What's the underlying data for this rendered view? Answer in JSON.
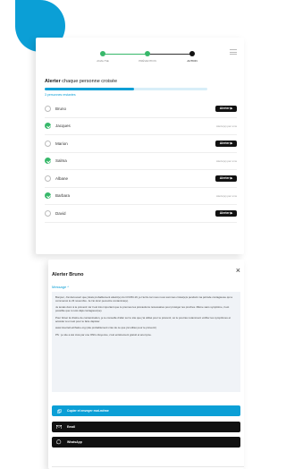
{
  "colors": {
    "accent": "#0b9fd6",
    "success": "#37b86a",
    "dark": "#111111"
  },
  "stepper": {
    "steps": [
      {
        "label": "Analyse",
        "state": "done"
      },
      {
        "label": "Prévention",
        "state": "done"
      },
      {
        "label": "Action",
        "state": "current"
      }
    ]
  },
  "alert_panel": {
    "title_bold": "Alerter",
    "title_rest": " chaque personne croisée",
    "progress_fraction": 0.55,
    "done_text": "3 personnes restantes",
    "alert_label": "Alerter ▶",
    "alerted_label": "Alerté(e) par sms",
    "people": [
      {
        "name": "Bruno",
        "checked": false
      },
      {
        "name": "Jacques",
        "checked": true
      },
      {
        "name": "Marion",
        "checked": false
      },
      {
        "name": "Salma",
        "checked": true
      },
      {
        "name": "Albane",
        "checked": false
      },
      {
        "name": "Barbara",
        "checked": true
      },
      {
        "name": "David",
        "checked": false
      }
    ]
  },
  "modal": {
    "title": "Alerter Bruno",
    "close": "×",
    "message_toggle": "Message ^",
    "paragraphs": [
      "Bonjour, J'ai découvert que j'étais probablement atteint(e) du COVID-19, je t'écris car nous nous sommes croisé(e)s pendant ma période contagieuse qui a commencé le 23 novembre. Je t'ai donc peut-être contaminé(e).",
      "Je tenais donc à te prévenir car il est très important que tu prennes les précautions nécessaires pour protéger tes proches. Même sans symptôme, il est possible que tu sois déjà contagieux(se).",
      "Pour briser la chaîne de contamination, je te conseille d'aller sur le site que j'ai utilisé pour te prévenir, où tu pourras notamment vérifier tes symptômes et accéder à un test pour te faire dépister.",
      "www.ALerterLaChaine.org (site probablement créé de ce que j'ai utilisé pour te prévenir)",
      "PS : je site a été créé par une ONG citoyenne, c'est entièrement gratuit et anonyme."
    ],
    "share_buttons": [
      {
        "label": "Copier et envoyer mot-même",
        "icon": "copy-icon",
        "kind": "copy"
      },
      {
        "label": "Email",
        "icon": "email-icon",
        "kind": "email"
      },
      {
        "label": "WhatsApp",
        "icon": "whatsapp-icon",
        "kind": "wa"
      }
    ]
  }
}
